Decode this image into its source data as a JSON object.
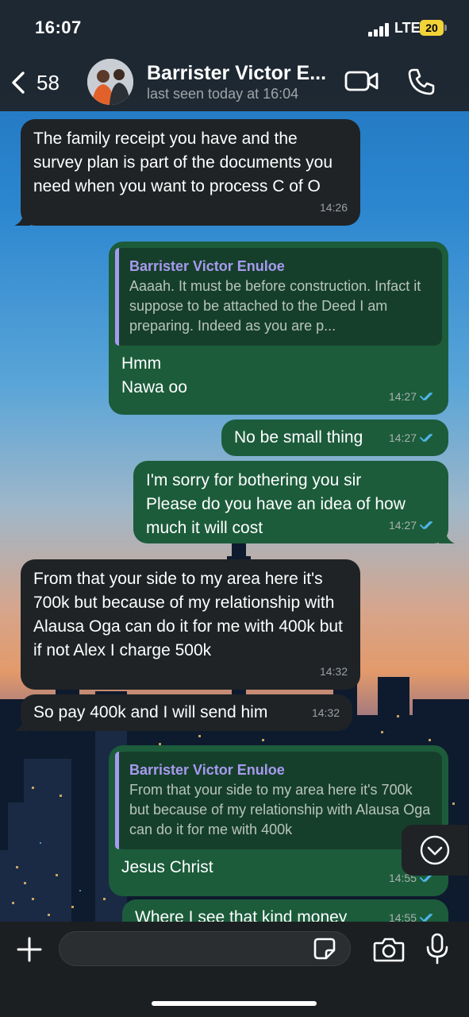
{
  "status_bar": {
    "time": "16:07",
    "network": "LTE",
    "battery": "20"
  },
  "header": {
    "back_count": "58",
    "contact_name": "Barrister Victor E...",
    "last_seen": "last seen today at 16:04"
  },
  "messages": [
    {
      "direction": "in",
      "text": "The family receipt you have and the survey plan is part of the documents you need when you want to process C of O",
      "time": "14:26"
    },
    {
      "direction": "out",
      "reply_name": "Barrister Victor Enuloe",
      "reply_text": "Aaaah. It must be before construction. Infact it suppose to be attached to the Deed I am preparing. Indeed as you are p...",
      "text_lines": [
        "Hmm",
        "Nawa oo"
      ],
      "time": "14:27"
    },
    {
      "direction": "out",
      "text": "No be small thing",
      "time": "14:27"
    },
    {
      "direction": "out",
      "text_lines": [
        "I'm sorry for bothering you sir",
        "Please do you have an idea of how much it will cost"
      ],
      "time": "14:27"
    },
    {
      "direction": "in",
      "text": "From that your side to my area here it's 700k but because of my relationship with Alausa Oga can do it for me with 400k but if not Alex I charge 500k",
      "time": "14:32"
    },
    {
      "direction": "in",
      "text": "So pay 400k and I will send him",
      "time": "14:32"
    },
    {
      "direction": "out",
      "reply_name": "Barrister Victor Enuloe",
      "reply_text": "From that your side to my area here it's 700k but because of my relationship with Alausa Oga can do it for me with 400k",
      "text": "Jesus Christ",
      "time": "14:55"
    },
    {
      "direction": "out",
      "text": "Where I see that kind money",
      "time": "14:55"
    }
  ],
  "composer": {
    "placeholder": ""
  },
  "icons": {
    "back": "chevron-left-icon",
    "video": "video-camera-icon",
    "call": "phone-icon",
    "scroll": "chevron-down-icon",
    "plus": "plus-icon",
    "sticker": "sticker-icon",
    "camera": "camera-icon",
    "mic": "microphone-icon"
  },
  "colors": {
    "incoming_bubble": "#1f2326",
    "outgoing_bubble": "#1c5c3b",
    "reply_accent": "#a79af0",
    "read_ticks": "#4fb6ec"
  }
}
